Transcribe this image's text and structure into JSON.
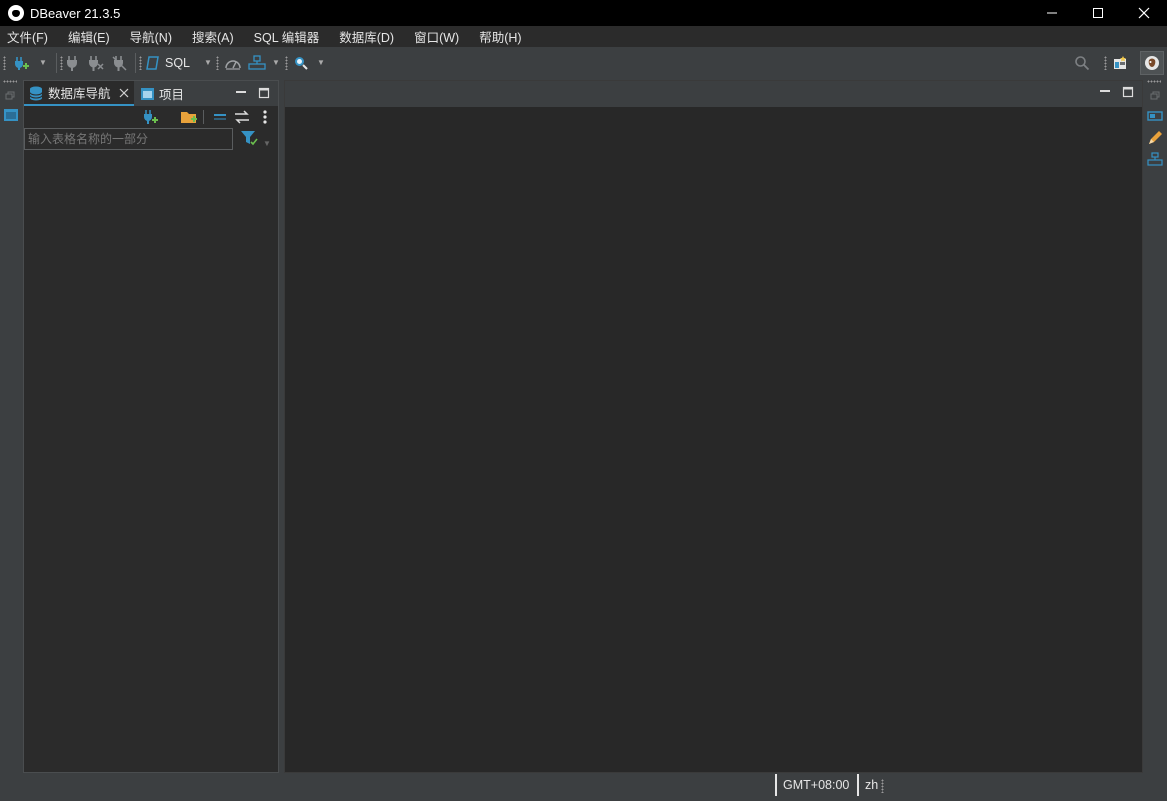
{
  "window": {
    "title": "DBeaver 21.3.5",
    "minimize": "—",
    "maximize": "☐",
    "close": "✕"
  },
  "menu": [
    "文件(F)",
    "编辑(E)",
    "导航(N)",
    "搜索(A)",
    "SQL 编辑器",
    "数据库(D)",
    "窗口(W)",
    "帮助(H)"
  ],
  "toolbar": {
    "sql_label": "SQL",
    "icons": [
      "new-connection-icon",
      "connect-icon",
      "disconnect-icon",
      "invalidate-icon",
      "sql-editor-icon",
      "dashboard-icon",
      "transaction-icon",
      "search-icon",
      "global-search-icon",
      "perspective-icon",
      "dbeaver-perspective-icon"
    ],
    "accent": "#3592c4"
  },
  "navigator": {
    "tabs": [
      {
        "label": "数据库导航",
        "active": true
      },
      {
        "label": "项目",
        "active": false
      }
    ],
    "filter_placeholder": "输入表格名称的一部分"
  },
  "statusbar": {
    "timezone": "GMT+08:00",
    "locale": "zh"
  }
}
